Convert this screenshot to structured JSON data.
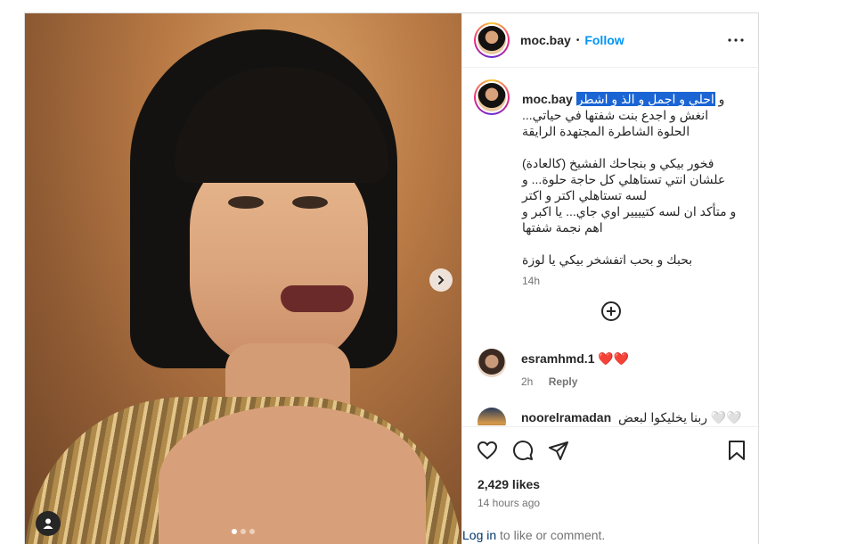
{
  "post": {
    "username": "moc.bay",
    "follow_label": "Follow",
    "separator": "•",
    "caption_user": "moc.bay",
    "caption_highlight": "احلي و اجمل و الذ و اشطر",
    "caption_first_tail": " و",
    "caption_lines": [
      "انغش و اجدع بنت شفتها في حياتي...",
      "الحلوة الشاطرة المجتهدة الرايقة",
      "",
      "فخور بيكي و بنجاحك الفشيخ (كالعادة)",
      "علشان انتي تستاهلي كل حاجة حلوة... و",
      "لسه تستاهلي اكتر و اكتر",
      "و متأكد ان لسه كتيييير اوي جاي... يا اكبر و",
      "اهم نجمة شفتها",
      "",
      "بحبك و بحب اتفشخر بيكي يا لوزة"
    ],
    "caption_time": "14h",
    "likes": "2,429 likes",
    "time_ago": "14 hours ago",
    "login_link": "Log in",
    "login_rest": " to like or comment."
  },
  "comments": [
    {
      "user": "esramhmd.1",
      "text": "❤️❤️",
      "time": "2h",
      "reply": "Reply"
    },
    {
      "user": "noorelramadan",
      "text": "ربنا يخليكوا لبعض 🤍🤍"
    }
  ],
  "icons": {
    "more": "more-options-icon",
    "next": "chevron-right-icon",
    "tag": "user-tag-icon",
    "plus": "load-more-icon",
    "like": "heart-icon",
    "comment": "comment-icon",
    "share": "send-icon",
    "save": "bookmark-icon"
  },
  "colors": {
    "follow": "#0095f6",
    "highlight": "#1a64d4",
    "heart": "#ed4956"
  }
}
